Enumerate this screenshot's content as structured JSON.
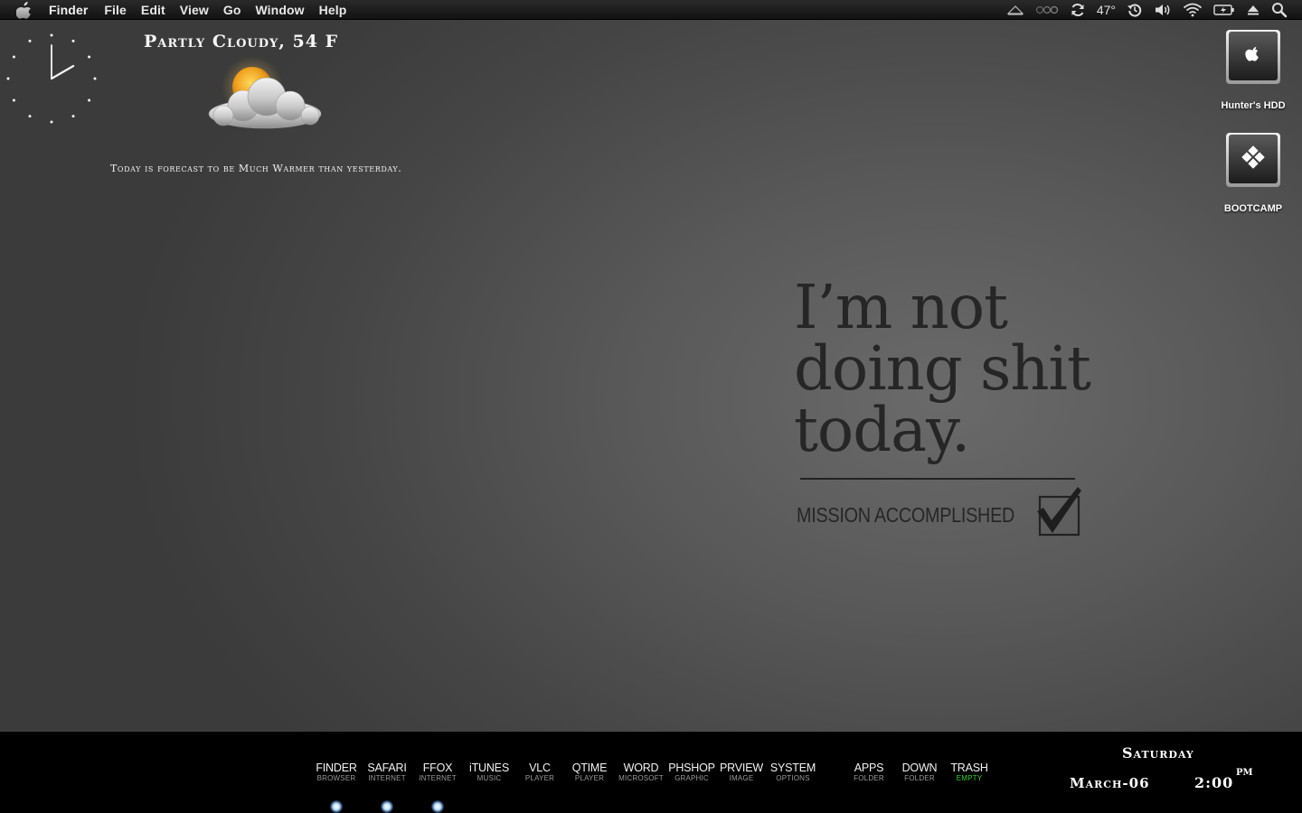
{
  "menubar": {
    "app_name": "Finder",
    "items": [
      "File",
      "Edit",
      "View",
      "Go",
      "Window",
      "Help"
    ],
    "status": {
      "temperature": "47°"
    }
  },
  "weather": {
    "title": "Partly Cloudy, 54 F",
    "forecast": "Today is forecast to be Much Warmer than yesterday."
  },
  "clock": {
    "hour": 2,
    "minute": 0
  },
  "desktop_icons": [
    {
      "label": "Hunter's HDD"
    },
    {
      "label": "BOOTCAMP"
    }
  ],
  "wallpaper": {
    "lines": [
      "I’m not",
      "doing shit",
      "today."
    ],
    "caption": "MISSION ACCOMPLISHED"
  },
  "dock": {
    "items": [
      {
        "name": "FINDER",
        "sub": "BROWSER"
      },
      {
        "name": "SAFARI",
        "sub": "INTERNET"
      },
      {
        "name": "FFOX",
        "sub": "INTERNET"
      },
      {
        "name": "iTUNES",
        "sub": "MUSIC"
      },
      {
        "name": "VLC",
        "sub": "PLAYER"
      },
      {
        "name": "QTIME",
        "sub": "PLAYER"
      },
      {
        "name": "WORD",
        "sub": "MICROSOFT"
      },
      {
        "name": "PHSHOP",
        "sub": "GRAPHIC"
      },
      {
        "name": "PRVIEW",
        "sub": "IMAGE"
      },
      {
        "name": "SYSTEM",
        "sub": "OPTIONS"
      },
      {
        "name": "APPS",
        "sub": "FOLDER"
      },
      {
        "name": "DOWN",
        "sub": "FOLDER"
      },
      {
        "name": "TRASH",
        "sub": "EMPTY"
      }
    ],
    "accent_green": "#39d339"
  },
  "datetime": {
    "day": "Saturday",
    "date": "March-06",
    "time": "2:00",
    "ampm": "PM"
  }
}
